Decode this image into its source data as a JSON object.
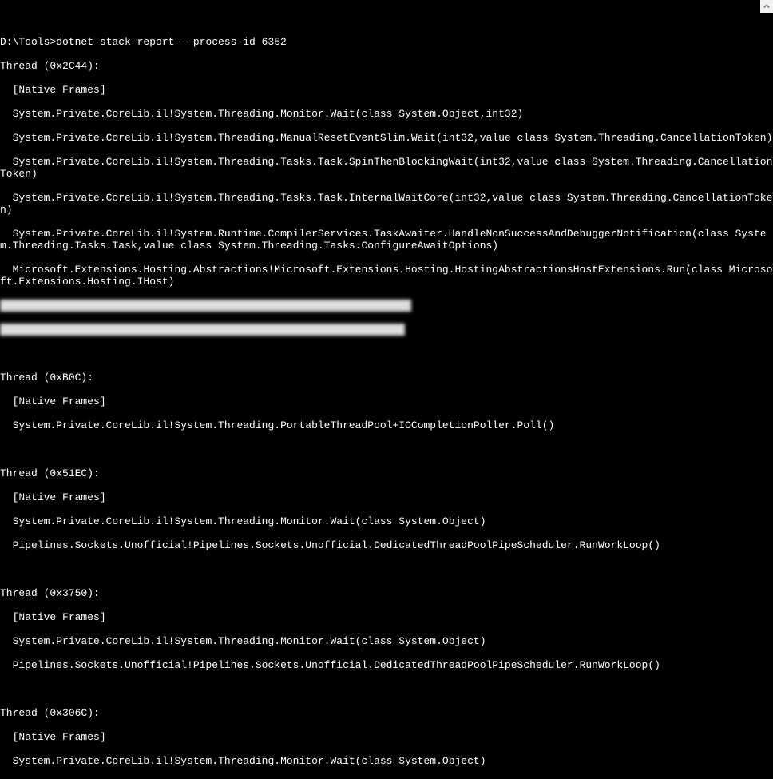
{
  "terminal": {
    "blank_line": " ",
    "prompt_line": "D:\\Tools>dotnet-stack report --process-id 6352",
    "threads": [
      {
        "header": "Thread (0x2C44):",
        "frames": [
          "  [Native Frames]",
          "  System.Private.CoreLib.il!System.Threading.Monitor.Wait(class System.Object,int32)",
          "  System.Private.CoreLib.il!System.Threading.ManualResetEventSlim.Wait(int32,value class System.Threading.CancellationToken)",
          "  System.Private.CoreLib.il!System.Threading.Tasks.Task.SpinThenBlockingWait(int32,value class System.Threading.CancellationToken)",
          "  System.Private.CoreLib.il!System.Threading.Tasks.Task.InternalWaitCore(int32,value class System.Threading.CancellationToken)",
          "  System.Private.CoreLib.il!System.Runtime.CompilerServices.TaskAwaiter.HandleNonSuccessAndDebuggerNotification(class System.Threading.Tasks.Task,value class System.Threading.Tasks.ConfigureAwaitOptions)",
          "  Microsoft.Extensions.Hosting.Abstractions!Microsoft.Extensions.Hosting.HostingAbstractionsHostExtensions.Run(class Microsoft.Extensions.Hosting.IHost)"
        ],
        "redacted_lines": [
          "  xxxxxxxxxxxxxxxxxxxxxxxxxxxxxxxxxxxxxxxxxxxxxxxxxxxxxxxxxxxst[])",
          "  xxxxxxxxxxxxxxxxxxxxxxxxxxxxxxxxxxxxxxxxxxxxxxxxxxxxxxxxxxxxxxx"
        ]
      },
      {
        "header": "Thread (0xB0C):",
        "frames": [
          "  [Native Frames]",
          "  System.Private.CoreLib.il!System.Threading.PortableThreadPool+IOCompletionPoller.Poll()"
        ]
      },
      {
        "header": "Thread (0x51EC):",
        "frames": [
          "  [Native Frames]",
          "  System.Private.CoreLib.il!System.Threading.Monitor.Wait(class System.Object)",
          "  Pipelines.Sockets.Unofficial!Pipelines.Sockets.Unofficial.DedicatedThreadPoolPipeScheduler.RunWorkLoop()"
        ]
      },
      {
        "header": "Thread (0x3750):",
        "frames": [
          "  [Native Frames]",
          "  System.Private.CoreLib.il!System.Threading.Monitor.Wait(class System.Object)",
          "  Pipelines.Sockets.Unofficial!Pipelines.Sockets.Unofficial.DedicatedThreadPoolPipeScheduler.RunWorkLoop()"
        ]
      },
      {
        "header": "Thread (0x306C):",
        "frames": [
          "  [Native Frames]",
          "  System.Private.CoreLib.il!System.Threading.Monitor.Wait(class System.Object)"
        ]
      }
    ]
  }
}
